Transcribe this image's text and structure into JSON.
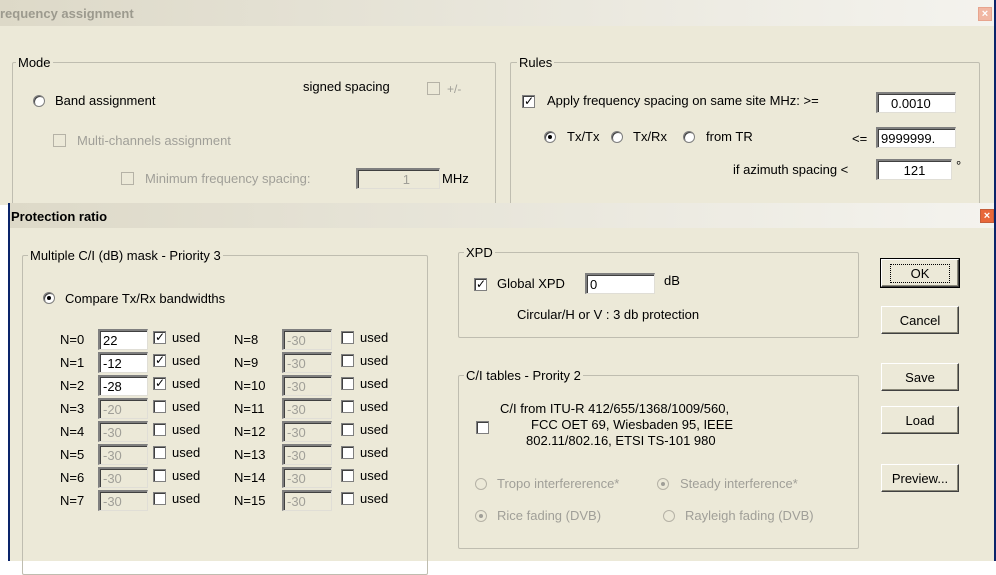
{
  "back_dialog": {
    "title": "requency assignment",
    "mode_group": "Mode",
    "signed_spacing": "signed spacing",
    "plus_minus": "+/-",
    "band_assignment": "Band assignment",
    "multi_channels": "Multi-channels assignment",
    "min_spacing_label": "Minimum frequency spacing:",
    "min_spacing_value": "1",
    "mhz": "MHz",
    "rules_group": "Rules",
    "apply_spacing": "Apply frequency spacing on same site MHz: >=",
    "spacing_min": "0.0010",
    "txtx": "Tx/Tx",
    "txrx": "Tx/Rx",
    "from_tr": "from TR",
    "le": "<=",
    "spacing_max": "9999999.",
    "azimuth_label": "if azimuth spacing <",
    "azimuth_value": "121",
    "degree": "°"
  },
  "dialog": {
    "title": "Protection ratio",
    "mask_group": "Multiple C/I (dB) mask - Priority 3",
    "compare_label": "Compare Tx/Rx bandwidths",
    "used_label": "used",
    "left_rows": [
      {
        "label": "N=0",
        "value": "22",
        "used": true
      },
      {
        "label": "N=1",
        "value": "-12",
        "used": true
      },
      {
        "label": "N=2",
        "value": "-28",
        "used": true
      },
      {
        "label": "N=3",
        "value": "-20",
        "used": false
      },
      {
        "label": "N=4",
        "value": "-30",
        "used": false
      },
      {
        "label": "N=5",
        "value": "-30",
        "used": false
      },
      {
        "label": "N=6",
        "value": "-30",
        "used": false
      },
      {
        "label": "N=7",
        "value": "-30",
        "used": false
      }
    ],
    "right_rows": [
      {
        "label": "N=8",
        "value": "-30",
        "used": false
      },
      {
        "label": "N=9",
        "value": "-30",
        "used": false
      },
      {
        "label": "N=10",
        "value": "-30",
        "used": false
      },
      {
        "label": "N=11",
        "value": "-30",
        "used": false
      },
      {
        "label": "N=12",
        "value": "-30",
        "used": false
      },
      {
        "label": "N=13",
        "value": "-30",
        "used": false
      },
      {
        "label": "N=14",
        "value": "-30",
        "used": false
      },
      {
        "label": "N=15",
        "value": "-30",
        "used": false
      }
    ],
    "xpd_group": "XPD",
    "global_xpd": "Global XPD",
    "xpd_value": "0",
    "db": "dB",
    "circular": "Circular/H or V : 3 db protection",
    "ci_group": "C/I tables - Prority 2",
    "ci_text_1": "C/I from ITU-R 412/655/1368/1009/560,",
    "ci_text_2": "FCC OET 69, Wiesbaden 95, IEEE",
    "ci_text_3": "802.11/802.16, ETSI TS-101 980",
    "tropo": "Tropo interfererence*",
    "steady": "Steady interference*",
    "rice": "Rice fading (DVB)",
    "rayleigh": "Rayleigh fading (DVB)",
    "buttons": {
      "ok": "OK",
      "cancel": "Cancel",
      "save": "Save",
      "load": "Load",
      "preview": "Preview..."
    }
  },
  "colors": {
    "face": "#ece9d8",
    "title_start": "#ddd9c8",
    "title_end": "#f4f3ee",
    "disabled_text": "#a09f98",
    "close": "#e8673a"
  },
  "icons": [
    "close-icon",
    "check-icon",
    "radio-dot-icon"
  ]
}
